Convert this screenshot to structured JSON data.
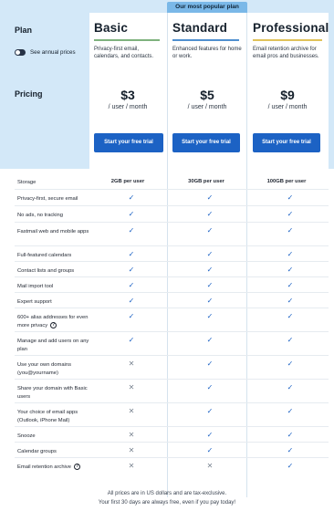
{
  "header": {
    "popular_badge": "Our most popular plan",
    "plan_label": "Plan",
    "annual_toggle_label": "See annual prices",
    "pricing_label": "Pricing"
  },
  "plans": [
    {
      "name": "Basic",
      "accent": "#7fb27e",
      "description": "Privacy-first email, calendars, and contacts.",
      "price": "$3",
      "per": "/ user / month",
      "cta": "Start your free trial"
    },
    {
      "name": "Standard",
      "accent": "#4f8fcf",
      "description": "Enhanced features for home or work.",
      "price": "$5",
      "per": "/ user / month",
      "cta": "Start your free trial"
    },
    {
      "name": "Professional",
      "accent": "#e0c25a",
      "description": "Email retention archive for email pros and businesses.",
      "price": "$9",
      "per": "/ user / month",
      "cta": "Start your free trial"
    }
  ],
  "features": [
    {
      "label": "Storage",
      "values": [
        "2GB per user",
        "30GB per user",
        "100GB per user"
      ]
    },
    {
      "label": "Privacy-first, secure email",
      "values": [
        "check",
        "check",
        "check"
      ]
    },
    {
      "label": "No ads, no tracking",
      "values": [
        "check",
        "check",
        "check"
      ]
    },
    {
      "label": "Fastmail web and mobile apps",
      "values": [
        "check",
        "check",
        "check"
      ]
    },
    {
      "label": "Full-featured calendars",
      "values": [
        "check",
        "check",
        "check"
      ]
    },
    {
      "label": "Contact lists and groups",
      "values": [
        "check",
        "check",
        "check"
      ]
    },
    {
      "label": "Mail import tool",
      "values": [
        "check",
        "check",
        "check"
      ]
    },
    {
      "label": "Expert support",
      "values": [
        "check",
        "check",
        "check"
      ]
    },
    {
      "label": "600+ alias addresses for even more privacy",
      "help": true,
      "values": [
        "check",
        "check",
        "check"
      ]
    },
    {
      "label": "Manage and add users on any plan",
      "values": [
        "check",
        "check",
        "check"
      ]
    },
    {
      "label": "Use your own domains (you@yourname)",
      "values": [
        "cross",
        "check",
        "check"
      ]
    },
    {
      "label": "Share your domain with Basic users",
      "values": [
        "cross",
        "check",
        "check"
      ]
    },
    {
      "label": "Your choice of email apps (Outlook, iPhone Mail)",
      "values": [
        "cross",
        "check",
        "check"
      ]
    },
    {
      "label": "Snooze",
      "values": [
        "cross",
        "check",
        "check"
      ]
    },
    {
      "label": "Calendar groups",
      "values": [
        "cross",
        "check",
        "check"
      ]
    },
    {
      "label": "Email retention archive",
      "help": true,
      "values": [
        "cross",
        "cross",
        "check"
      ]
    }
  ],
  "footer": {
    "line1": "All prices are in US dollars and are tax-exclusive.",
    "line2": "Your first 30 days are always free, even if you pay today!"
  },
  "icons": {
    "check": "checkmark-icon",
    "cross": "cross-icon",
    "help": "help-circle-icon"
  }
}
